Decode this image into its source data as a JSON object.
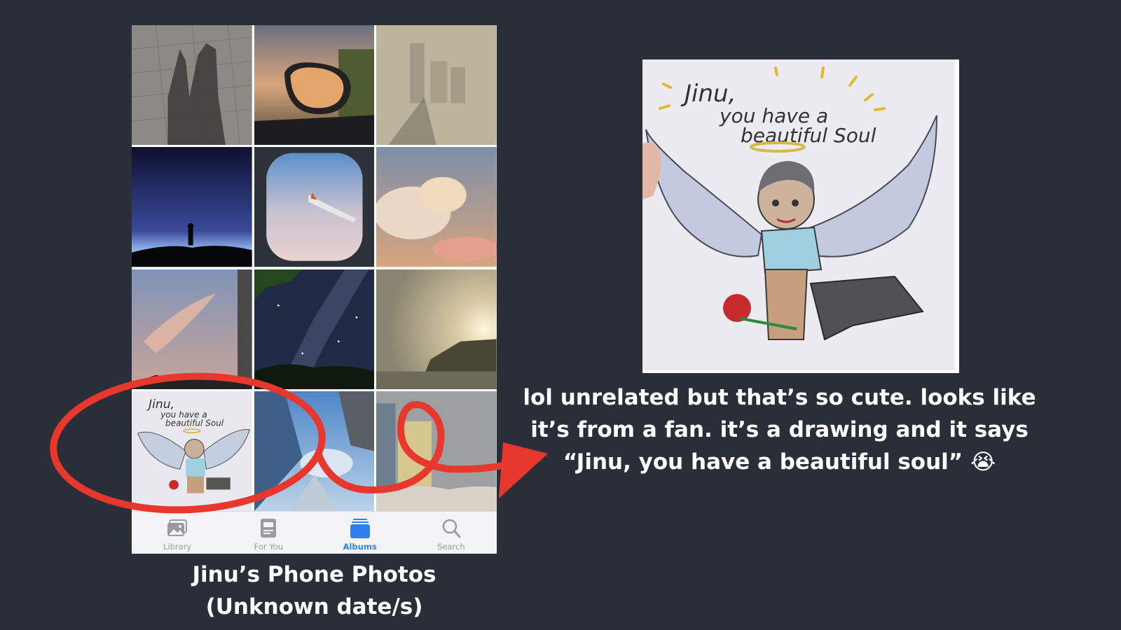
{
  "tabbar": {
    "tabs": [
      {
        "label": "Library",
        "icon": "photo-library-icon",
        "active": false
      },
      {
        "label": "For You",
        "icon": "for-you-icon",
        "active": false
      },
      {
        "label": "Albums",
        "icon": "albums-icon",
        "active": true
      },
      {
        "label": "Search",
        "icon": "search-icon",
        "active": false
      }
    ]
  },
  "caption": {
    "line1": "Jinu’s Phone Photos",
    "line2": "(Unknown date/s)"
  },
  "drawing": {
    "line1": "Jinu,",
    "line2": "you have a",
    "line3": "beautiful Soul"
  },
  "comment": {
    "line1": "lol unrelated but that’s so cute. looks like",
    "line2": "it’s from a fan. it’s a drawing and it says",
    "line3": "“Jinu, you have a beautiful soul” 😭"
  },
  "colors": {
    "background": "#2a2e39",
    "annotation_red": "#e8372c",
    "active_tab": "#2f80ed"
  }
}
